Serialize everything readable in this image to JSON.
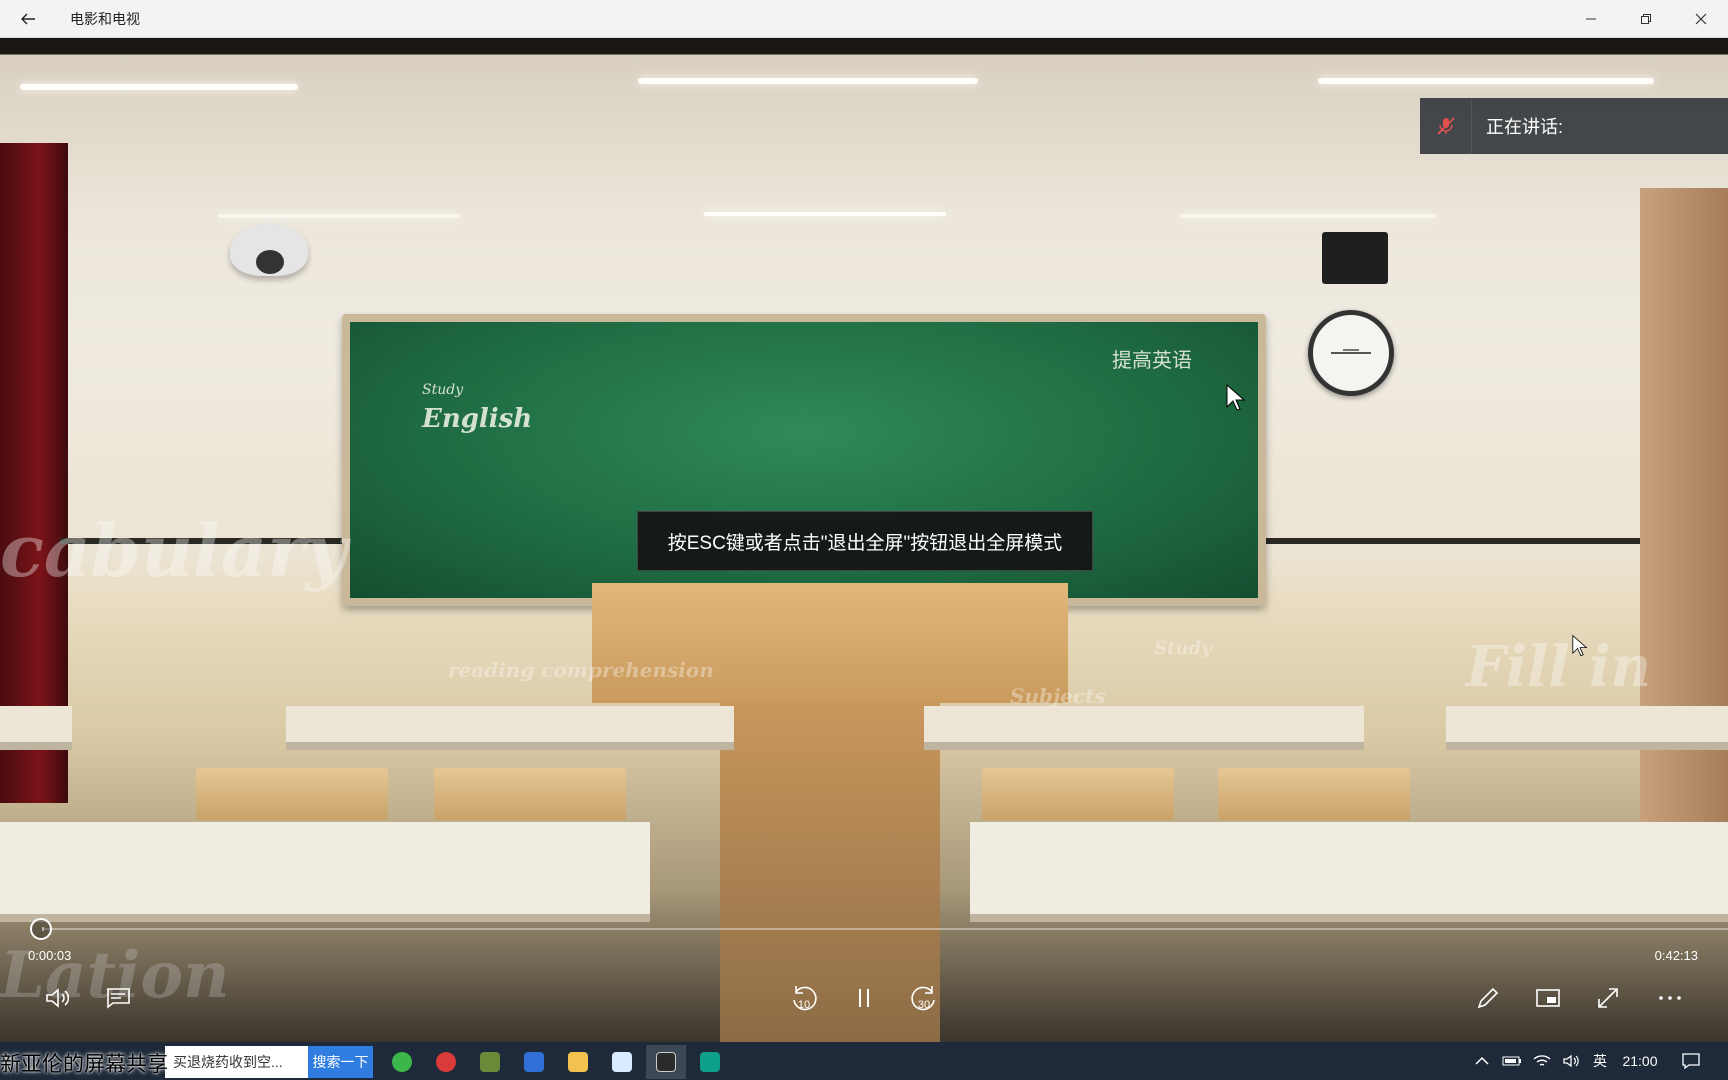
{
  "window": {
    "title": "电影和电视"
  },
  "overlay": {
    "toast": "按ESC键或者点击\"退出全屏\"按钮退出全屏模式",
    "speaking_label": "正在讲话:"
  },
  "chalkboard": {
    "left_text": "English",
    "left_small": "Study",
    "right_text": "提高英语"
  },
  "video_watermarks": {
    "left": "cabulary",
    "center": "reading comprehension",
    "right_a": "Study",
    "right_b": "Subjects",
    "far_right": "Fill in",
    "bottom_left": "Lation"
  },
  "player": {
    "current_time": "0:00:03",
    "total_time": "0:42:13",
    "progress_fraction": 0.001,
    "skip_back_seconds": "10",
    "skip_forward_seconds": "30"
  },
  "taskbar": {
    "share_label": "新亚伦的屏幕共享",
    "search_text": "买退烧药收到空...",
    "search_button": "搜索一下",
    "ime": "英",
    "clock": "21:00"
  }
}
